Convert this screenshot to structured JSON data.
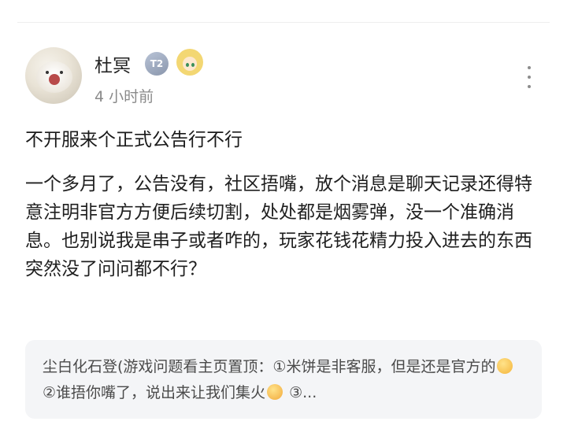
{
  "post": {
    "author": {
      "name": "杜冥",
      "level_badge": "T2",
      "time": "4 小时前"
    },
    "title": "不开服来个正式公告行不行",
    "body": "一个多月了，公告没有，社区捂嘴，放个消息是聊天记录还得特意注明非官方方便后续切割，处处都是烟雾弹，没一个准确消息。也别说我是串子或者咋的，玩家花钱花精力投入进去的东西突然没了问问都不行？",
    "comment_preview": {
      "author": "尘白化石登",
      "text_part1": "(游戏问题看主页置顶：①米饼是非客服，但是还是官方的",
      "text_part2": " ②谁捂你嘴了，说出来让我们集火",
      "text_part3": " ③..."
    }
  }
}
